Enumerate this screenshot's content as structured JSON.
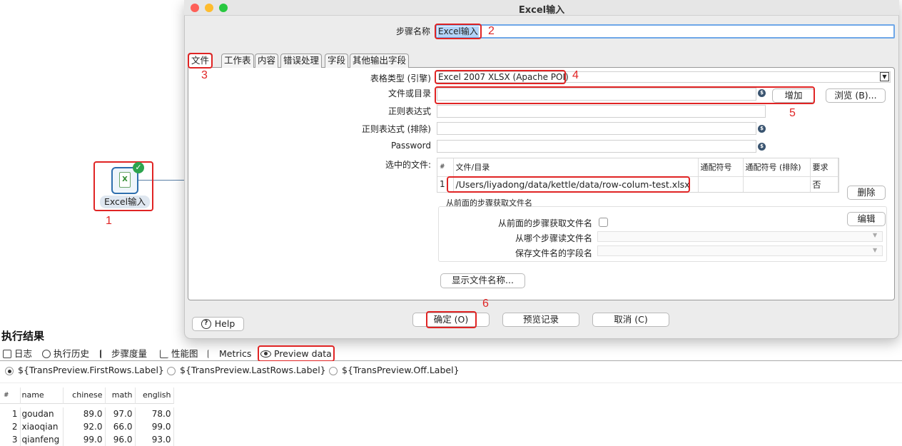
{
  "canvas": {
    "step_label": "Excel输入",
    "anno1": "1"
  },
  "dialog": {
    "title": "Excel输入",
    "step_name_label": "步骤名称",
    "step_name_value": "Excel输入",
    "anno2": "2",
    "tabs": [
      "文件",
      "工作表",
      "内容",
      "错误处理",
      "字段",
      "其他输出字段"
    ],
    "anno3": "3",
    "spreadsheet_type_label": "表格类型 (引擎)",
    "spreadsheet_type_value": "Excel 2007 XLSX (Apache POI)",
    "anno4": "4",
    "file_dir_label": "文件或目录",
    "file_dir_value": "",
    "add_button": "增加",
    "browse_button": "浏览 (B)...",
    "anno5": "5",
    "regex_label": "正则表达式",
    "regex_exclude_label": "正则表达式 (排除)",
    "password_label": "Password",
    "selected_files_label": "选中的文件:",
    "files_table": {
      "headers": [
        "#",
        "文件/目录",
        "通配符号",
        "通配符号 (排除)",
        "要求"
      ],
      "rows": [
        {
          "num": "1",
          "path": "/Users/liyadong/data/kettle/data/row-colum-test.xlsx",
          "wild": "",
          "wild_ex": "",
          "req": "否"
        }
      ]
    },
    "delete_button": "删除",
    "edit_button": "编辑",
    "prev_group_label": "从前面的步骤获取文件名",
    "prev_check_label": "从前面的步骤获取文件名",
    "from_step_label": "从哪个步骤读文件名",
    "save_field_label": "保存文件名的字段名",
    "show_files_button": "显示文件名称...",
    "anno6": "6",
    "help_button": "Help",
    "ok_button": "确定 (O)",
    "preview_button": "预览记录",
    "cancel_button": "取消 (C)"
  },
  "results": {
    "title": "执行结果",
    "tabs": [
      "日志",
      "执行历史",
      "步骤度量",
      "性能图",
      "Metrics",
      "Preview data"
    ],
    "radios": [
      "${TransPreview.FirstRows.Label}",
      "${TransPreview.LastRows.Label}",
      "${TransPreview.Off.Label}"
    ],
    "table_headers": [
      "#",
      "name",
      "chinese",
      "math",
      "english"
    ],
    "rows": [
      [
        "1",
        "goudan",
        "89.0",
        "97.0",
        "78.0"
      ],
      [
        "2",
        "xiaoqian",
        "92.0",
        "66.0",
        "99.0"
      ],
      [
        "3",
        "qianfeng",
        "99.0",
        "96.0",
        "93.0"
      ]
    ]
  },
  "colors": {
    "annotation": "#e02424",
    "accent": "#3478f6"
  }
}
